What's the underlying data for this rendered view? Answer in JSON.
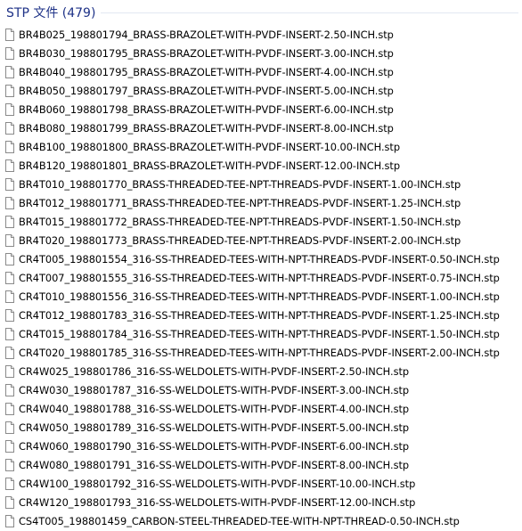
{
  "group": {
    "title": "STP 文件 (479)"
  },
  "files": [
    {
      "name": "BR4B025_198801794_BRASS-BRAZOLET-WITH-PVDF-INSERT-2.50-INCH.stp"
    },
    {
      "name": "BR4B030_198801795_BRASS-BRAZOLET-WITH-PVDF-INSERT-3.00-INCH.stp"
    },
    {
      "name": "BR4B040_198801795_BRASS-BRAZOLET-WITH-PVDF-INSERT-4.00-INCH.stp"
    },
    {
      "name": "BR4B050_198801797_BRASS-BRAZOLET-WITH-PVDF-INSERT-5.00-INCH.stp"
    },
    {
      "name": "BR4B060_198801798_BRASS-BRAZOLET-WITH-PVDF-INSERT-6.00-INCH.stp"
    },
    {
      "name": "BR4B080_198801799_BRASS-BRAZOLET-WITH-PVDF-INSERT-8.00-INCH.stp"
    },
    {
      "name": "BR4B100_198801800_BRASS-BRAZOLET-WITH-PVDF-INSERT-10.00-INCH.stp"
    },
    {
      "name": "BR4B120_198801801_BRASS-BRAZOLET-WITH-PVDF-INSERT-12.00-INCH.stp"
    },
    {
      "name": "BR4T010_198801770_BRASS-THREADED-TEE-NPT-THREADS-PVDF-INSERT-1.00-INCH.stp"
    },
    {
      "name": "BR4T012_198801771_BRASS-THREADED-TEE-NPT-THREADS-PVDF-INSERT-1.25-INCH.stp"
    },
    {
      "name": "BR4T015_198801772_BRASS-THREADED-TEE-NPT-THREADS-PVDF-INSERT-1.50-INCH.stp"
    },
    {
      "name": "BR4T020_198801773_BRASS-THREADED-TEE-NPT-THREADS-PVDF-INSERT-2.00-INCH.stp"
    },
    {
      "name": "CR4T005_198801554_316-SS-THREADED-TEES-WITH-NPT-THREADS-PVDF-INSERT-0.50-INCH.stp"
    },
    {
      "name": "CR4T007_198801555_316-SS-THREADED-TEES-WITH-NPT-THREADS-PVDF-INSERT-0.75-INCH.stp"
    },
    {
      "name": "CR4T010_198801556_316-SS-THREADED-TEES-WITH-NPT-THREADS-PVDF-INSERT-1.00-INCH.stp"
    },
    {
      "name": "CR4T012_198801783_316-SS-THREADED-TEES-WITH-NPT-THREADS-PVDF-INSERT-1.25-INCH.stp"
    },
    {
      "name": "CR4T015_198801784_316-SS-THREADED-TEES-WITH-NPT-THREADS-PVDF-INSERT-1.50-INCH.stp"
    },
    {
      "name": "CR4T020_198801785_316-SS-THREADED-TEES-WITH-NPT-THREADS-PVDF-INSERT-2.00-INCH.stp"
    },
    {
      "name": "CR4W025_198801786_316-SS-WELDOLETS-WITH-PVDF-INSERT-2.50-INCH.stp"
    },
    {
      "name": "CR4W030_198801787_316-SS-WELDOLETS-WITH-PVDF-INSERT-3.00-INCH.stp"
    },
    {
      "name": "CR4W040_198801788_316-SS-WELDOLETS-WITH-PVDF-INSERT-4.00-INCH.stp"
    },
    {
      "name": "CR4W050_198801789_316-SS-WELDOLETS-WITH-PVDF-INSERT-5.00-INCH.stp"
    },
    {
      "name": "CR4W060_198801790_316-SS-WELDOLETS-WITH-PVDF-INSERT-6.00-INCH.stp"
    },
    {
      "name": "CR4W080_198801791_316-SS-WELDOLETS-WITH-PVDF-INSERT-8.00-INCH.stp"
    },
    {
      "name": "CR4W100_198801792_316-SS-WELDOLETS-WITH-PVDF-INSERT-10.00-INCH.stp"
    },
    {
      "name": "CR4W120_198801793_316-SS-WELDOLETS-WITH-PVDF-INSERT-12.00-INCH.stp"
    },
    {
      "name": "CS4T005_198801459_CARBON-STEEL-THREADED-TEE-WITH-NPT-THREAD-0.50-INCH.stp"
    }
  ],
  "icons": {
    "file": "file-icon"
  }
}
